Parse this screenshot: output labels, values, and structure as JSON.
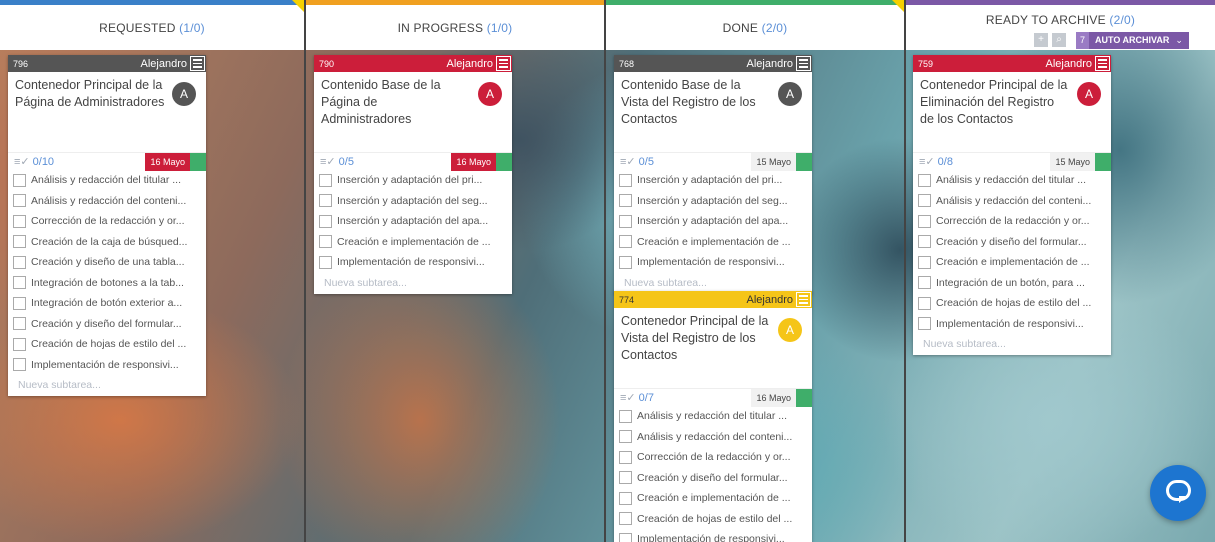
{
  "columns": [
    {
      "name": "REQUESTED",
      "count": "(1/0)",
      "bar_color": "#3a80c8"
    },
    {
      "name": "IN PROGRESS",
      "count": "(1/0)",
      "bar_color": "#f0a020"
    },
    {
      "name": "DONE",
      "count": "(2/0)",
      "bar_color": "#3fae6a"
    },
    {
      "name": "READY TO ARCHIVE",
      "count": "(2/0)",
      "bar_color": "#7b58a6"
    }
  ],
  "archive_tools": {
    "plus_icon": "plus-icon",
    "search_icon": "search-icon",
    "count": "7",
    "label": "AUTO ARCHIVAR",
    "chevron": "⌄"
  },
  "colors": {
    "red": "#cc1e3a",
    "dark": "#555555",
    "yellow": "#f5c518",
    "green": "#3fae6a",
    "link": "#5b8fd6"
  },
  "new_subtask_label": "Nueva subtarea...",
  "cards": [
    {
      "id": "796",
      "owner": "Alejandro",
      "head_color": "#555555",
      "title": "Contenedor Principal de la Página de Administradores",
      "avatar": "A",
      "avatar_color": "#555555",
      "progress": "0/10",
      "date": "16 Mayo",
      "date_style": "hot",
      "tasks": [
        "Análisis y redacción del titular ...",
        "Análisis y redacción del conteni...",
        "Corrección de la redacción y or...",
        "Creación de la caja de búsqued...",
        "Creación y diseño de una tabla...",
        "Integración de botones a la tab...",
        "Integración de botón exterior a...",
        "Creación y diseño del formular...",
        "Creación de hojas de estilo del ...",
        "Implementación de responsivi..."
      ]
    },
    {
      "id": "790",
      "owner": "Alejandro",
      "head_color": "#cc1e3a",
      "title": "Contenido Base de la Página de Administradores",
      "avatar": "A",
      "avatar_color": "#cc1e3a",
      "progress": "0/5",
      "date": "16 Mayo",
      "date_style": "hot",
      "tasks": [
        "Inserción y adaptación del pri...",
        "Inserción y adaptación del seg...",
        "Inserción y adaptación del apa...",
        "Creación e implementación de ...",
        "Implementación de responsivi..."
      ]
    },
    {
      "id": "768",
      "owner": "Alejandro",
      "head_color": "#555555",
      "title": "Contenido Base de la Vista del Registro de los Contactos",
      "avatar": "A",
      "avatar_color": "#555555",
      "progress": "0/5",
      "date": "15 Mayo",
      "date_style": "cool",
      "tasks": [
        "Inserción y adaptación del pri...",
        "Inserción y adaptación del seg...",
        "Inserción y adaptación del apa...",
        "Creación e implementación de ...",
        "Implementación de responsivi..."
      ]
    },
    {
      "id": "774",
      "owner": "Alejandro",
      "head_color": "#f5c518",
      "title": "Contenedor Principal de la Vista del Registro de los Contactos",
      "avatar": "A",
      "avatar_color": "#f5c518",
      "progress": "0/7",
      "date": "16 Mayo",
      "date_style": "cool",
      "tasks": [
        "Análisis y redacción del titular ...",
        "Análisis y redacción del conteni...",
        "Corrección de la redacción y or...",
        "Creación y diseño del formular...",
        "Creación e implementación de ...",
        "Creación de hojas de estilo del ...",
        "Implementación de responsivi..."
      ]
    },
    {
      "id": "759",
      "owner": "Alejandro",
      "head_color": "#cc1e3a",
      "title": "Contenedor Principal de la Eliminación del Registro de los Contactos",
      "avatar": "A",
      "avatar_color": "#cc1e3a",
      "progress": "0/8",
      "date": "15 Mayo",
      "date_style": "cool",
      "tasks": [
        "Análisis y redacción del titular ...",
        "Análisis y redacción del conteni...",
        "Corrección de la redacción y or...",
        "Creación y diseño del formular...",
        "Creación e implementación de ...",
        "Integración de un botón, para ...",
        "Creación de hojas de estilo del ...",
        "Implementación de responsivi..."
      ]
    }
  ],
  "chat_icon": "chat-bubble-icon"
}
